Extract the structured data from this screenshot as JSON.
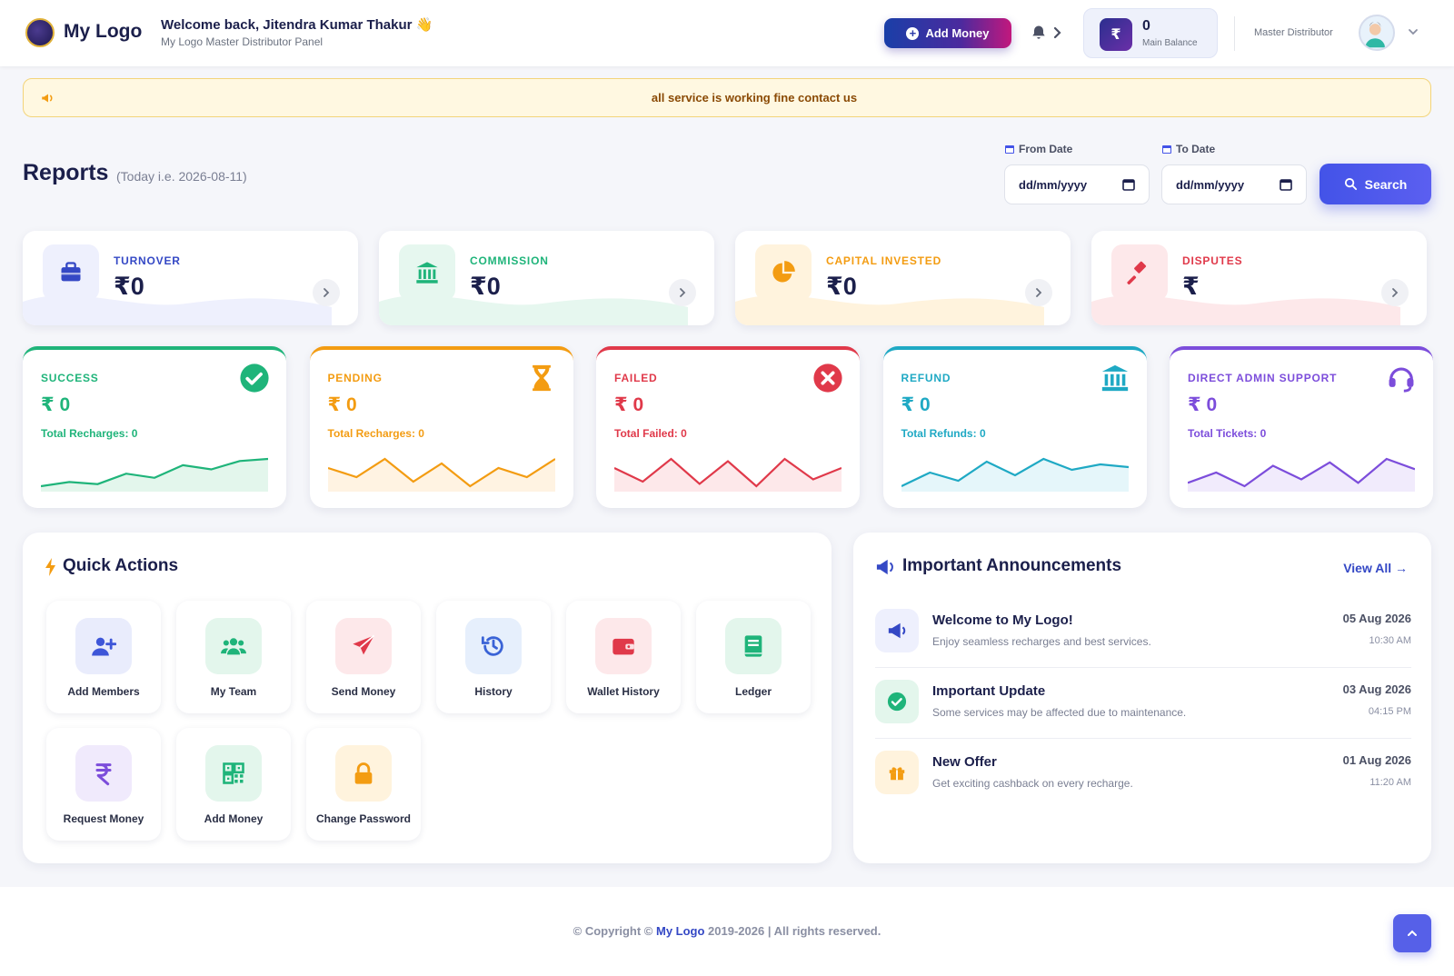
{
  "header": {
    "logo_text": "My Logo",
    "welcome": "Welcome back, Jitendra Kumar Thakur 👋",
    "panel_subtitle": "My Logo Master Distributor Panel",
    "add_money_label": "Add Money",
    "balance_value": "0",
    "balance_label": "Main Balance",
    "balance_icon": "₹",
    "role": "Master Distributor"
  },
  "notice": {
    "text": "all service is working fine contact us"
  },
  "reports": {
    "title": "Reports",
    "subtitle": "(Today i.e. 2026-08-11)",
    "from_label": "From Date",
    "to_label": "To Date",
    "from_value": "dd/mm/yyyy",
    "to_value": "dd/mm/yyyy",
    "search_label": "Search"
  },
  "stats": [
    {
      "label": "TURNOVER",
      "value": "₹0",
      "color": "#3448c5",
      "bg": "#eef0fd",
      "icon": "briefcase-icon"
    },
    {
      "label": "COMMISSION",
      "value": "₹0",
      "color": "#1fb47a",
      "bg": "#e6f7ef",
      "icon": "bank-icon"
    },
    {
      "label": "CAPITAL INVESTED",
      "value": "₹0",
      "color": "#f39c12",
      "bg": "#fff3dd",
      "icon": "pie-chart-icon"
    },
    {
      "label": "DISPUTES",
      "value": "₹",
      "color": "#e0394a",
      "bg": "#fde8ea",
      "icon": "gavel-icon"
    }
  ],
  "status_cards": [
    {
      "label": "SUCCESS",
      "value": "₹ 0",
      "sub": "Total Recharges: 0",
      "color": "#1fb47a",
      "fill": "#e3f6ec",
      "icon": "check-circle-icon",
      "trend": [
        2,
        4,
        3,
        8,
        6,
        12,
        10,
        14,
        15
      ]
    },
    {
      "label": "PENDING",
      "value": "₹ 0",
      "sub": "Total Recharges: 0",
      "color": "#f39c12",
      "fill": "#fff3e2",
      "icon": "hourglass-icon",
      "trend": [
        8,
        6,
        10,
        5,
        9,
        4,
        8,
        6,
        10
      ]
    },
    {
      "label": "FAILED",
      "value": "₹ 0",
      "sub": "Total Failed: 0",
      "color": "#e0394a",
      "fill": "#fde8ea",
      "icon": "x-circle-icon",
      "trend": [
        10,
        4,
        14,
        3,
        13,
        2,
        14,
        5,
        10
      ]
    },
    {
      "label": "REFUND",
      "value": "₹ 0",
      "sub": "Total Refunds: 0",
      "color": "#1fa9c4",
      "fill": "#e5f6fa",
      "icon": "bank-icon",
      "trend": [
        4,
        9,
        6,
        13,
        8,
        14,
        10,
        12,
        11
      ]
    },
    {
      "label": "DIRECT ADMIN SUPPORT",
      "value": "₹ 0",
      "sub": "Total Tickets: 0",
      "color": "#7c4ddb",
      "fill": "#f1ebfc",
      "icon": "headset-icon",
      "trend": [
        8,
        11,
        7,
        13,
        9,
        14,
        8,
        15,
        12
      ]
    }
  ],
  "quick_actions": {
    "title": "Quick Actions",
    "items": [
      {
        "label": "Add Members",
        "icon": "user-plus-icon",
        "color": "#3e56d8",
        "bg": "#e9ecfc"
      },
      {
        "label": "My Team",
        "icon": "users-icon",
        "color": "#1fb47a",
        "bg": "#e3f6ec"
      },
      {
        "label": "Send Money",
        "icon": "paper-plane-icon",
        "color": "#e0394a",
        "bg": "#fde8ea"
      },
      {
        "label": "History",
        "icon": "history-icon",
        "color": "#3a63d6",
        "bg": "#e6effc"
      },
      {
        "label": "Wallet History",
        "icon": "wallet-icon",
        "color": "#e0394a",
        "bg": "#fde8ea"
      },
      {
        "label": "Ledger",
        "icon": "book-icon",
        "color": "#1fb47a",
        "bg": "#e3f6ec"
      },
      {
        "label": "Request Money",
        "icon": "rupee-icon",
        "color": "#7c4ddb",
        "bg": "#f0eafc"
      },
      {
        "label": "Add Money",
        "icon": "qr-code-icon",
        "color": "#1fb47a",
        "bg": "#e3f6ec"
      },
      {
        "label": "Change Password",
        "icon": "lock-icon",
        "color": "#f39c12",
        "bg": "#fff3dd"
      }
    ]
  },
  "announcements": {
    "title": "Important Announcements",
    "view_all": "View All →",
    "items": [
      {
        "title": "Welcome to My Logo!",
        "desc": "Enjoy seamless recharges and best services.",
        "date": "05 Aug 2026",
        "time": "10:30 AM",
        "icon": "megaphone-icon",
        "color": "#3448c5",
        "bg": "#eef0fd"
      },
      {
        "title": "Important Update",
        "desc": "Some services may be affected due to maintenance.",
        "date": "03 Aug 2026",
        "time": "04:15 PM",
        "icon": "check-circle-icon",
        "color": "#1fb47a",
        "bg": "#e3f6ec"
      },
      {
        "title": "New Offer",
        "desc": "Get exciting cashback on every recharge.",
        "date": "01 Aug 2026",
        "time": "11:20 AM",
        "icon": "gift-icon",
        "color": "#f39c12",
        "bg": "#fff3dd"
      }
    ]
  },
  "footer": {
    "prefix": "© Copyright © ",
    "brand": "My Logo",
    "suffix": " 2019-2026 | All rights reserved."
  }
}
